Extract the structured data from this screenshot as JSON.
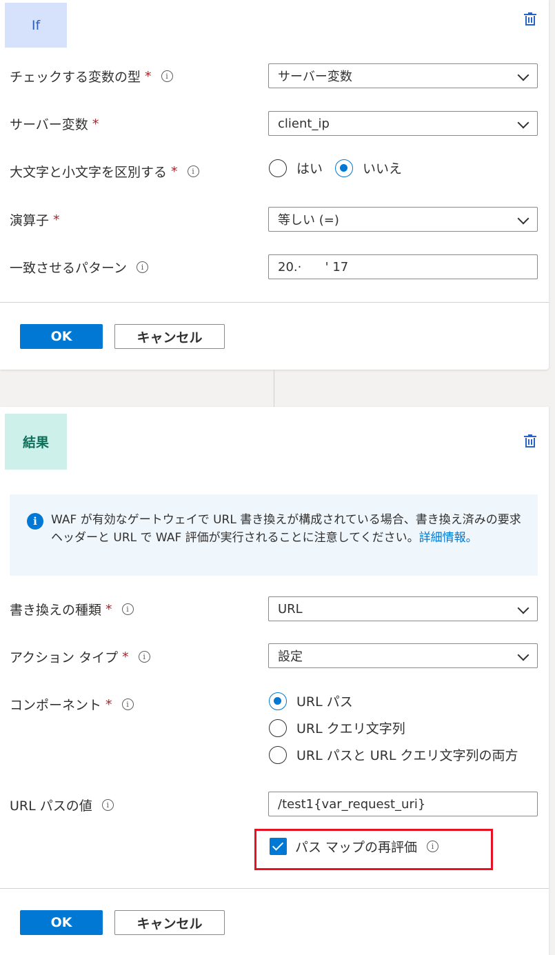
{
  "if_card": {
    "tag": "If",
    "fields": [
      {
        "label": "チェックする変数の型",
        "required": true,
        "info": true,
        "value": "サーバー変数"
      },
      {
        "label": "サーバー変数",
        "required": true,
        "info": false,
        "value": "client_ip"
      },
      {
        "label": "大文字と小文字を区別する",
        "required": true,
        "info": true
      },
      {
        "label": "演算子",
        "required": true,
        "info": false,
        "value": "等しい (=)"
      },
      {
        "label": "一致させるパターン",
        "required": false,
        "info": true,
        "value": "20.·      ' 17"
      }
    ],
    "case_radio": {
      "yes": "はい",
      "no": "いいえ",
      "selected": "いいえ"
    },
    "ok_label": "OK",
    "cancel_label": "キャンセル"
  },
  "result_card": {
    "tag": "結果",
    "info_text": "WAF が有効なゲートウェイで URL 書き換えが構成されている場合、書き換え済みの要求ヘッダーと URL で WAF 評価が実行されることに注意してください。",
    "info_link": "詳細情報。",
    "fields": [
      {
        "label": "書き換えの種類",
        "required": true,
        "info": true,
        "value": "URL"
      },
      {
        "label": "アクション タイプ",
        "required": true,
        "info": true,
        "value": "設定"
      },
      {
        "label": "コンポーネント",
        "required": true,
        "info": true
      },
      {
        "label": "URL パスの値",
        "required": false,
        "info": true,
        "value": "/test1{var_request_uri}"
      }
    ],
    "component_options": [
      "URL パス",
      "URL クエリ文字列",
      "URL パスと URL クエリ文字列の両方"
    ],
    "component_selected": "URL パス",
    "reevaluate_label": "パス マップの再評価",
    "reevaluate_checked": true,
    "ok_label": "OK",
    "cancel_label": "キャンセル"
  },
  "colors": {
    "accent": "#0078d4",
    "required": "#a4262c",
    "highlight": "#e81123"
  },
  "icons": [
    "trash-icon",
    "info-icon",
    "chevron-down-icon",
    "checkmark-icon"
  ]
}
